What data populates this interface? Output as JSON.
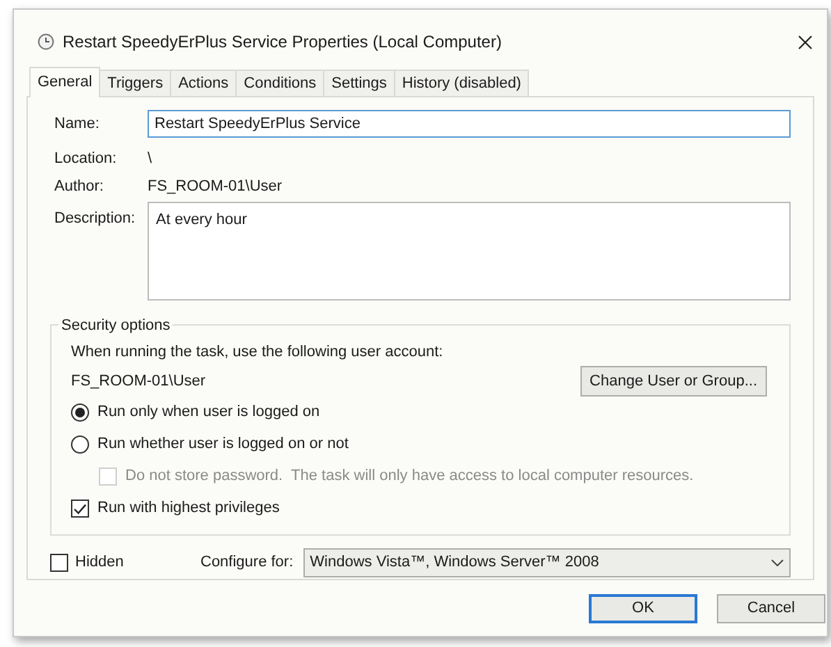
{
  "window": {
    "title": "Restart SpeedyErPlus Service Properties (Local Computer)"
  },
  "tabs": [
    {
      "label": "General",
      "selected": true
    },
    {
      "label": "Triggers",
      "selected": false
    },
    {
      "label": "Actions",
      "selected": false
    },
    {
      "label": "Conditions",
      "selected": false
    },
    {
      "label": "Settings",
      "selected": false
    },
    {
      "label": "History (disabled)",
      "selected": false
    }
  ],
  "general": {
    "name_label": "Name:",
    "name_value": "Restart SpeedyErPlus Service",
    "location_label": "Location:",
    "location_value": "\\",
    "author_label": "Author:",
    "author_value": "FS_ROOM-01\\User",
    "description_label": "Description:",
    "description_value": "At every hour"
  },
  "security": {
    "title": "Security options",
    "prompt": "When running the task, use the following user account:",
    "account": "FS_ROOM-01\\User",
    "change_button": "Change User or Group...",
    "options": [
      {
        "kind": "radio",
        "label": "Run only when user is logged on",
        "selected": true,
        "disabled": false
      },
      {
        "kind": "radio",
        "label": "Run whether user is logged on or not",
        "selected": false,
        "disabled": false,
        "children": [
          {
            "kind": "checkbox",
            "label": "Do not store password.  The task will only have access to local computer resources.",
            "checked": false,
            "disabled": true
          }
        ]
      },
      {
        "kind": "checkbox",
        "label": "Run with highest privileges",
        "checked": true,
        "disabled": false
      }
    ]
  },
  "hidden": {
    "label": "Hidden",
    "checked": false
  },
  "configure": {
    "label": "Configure for:",
    "value": "Windows Vista™, Windows Server™ 2008"
  },
  "buttons": [
    {
      "label": "OK",
      "default": true
    },
    {
      "label": "Cancel",
      "default": false
    }
  ]
}
